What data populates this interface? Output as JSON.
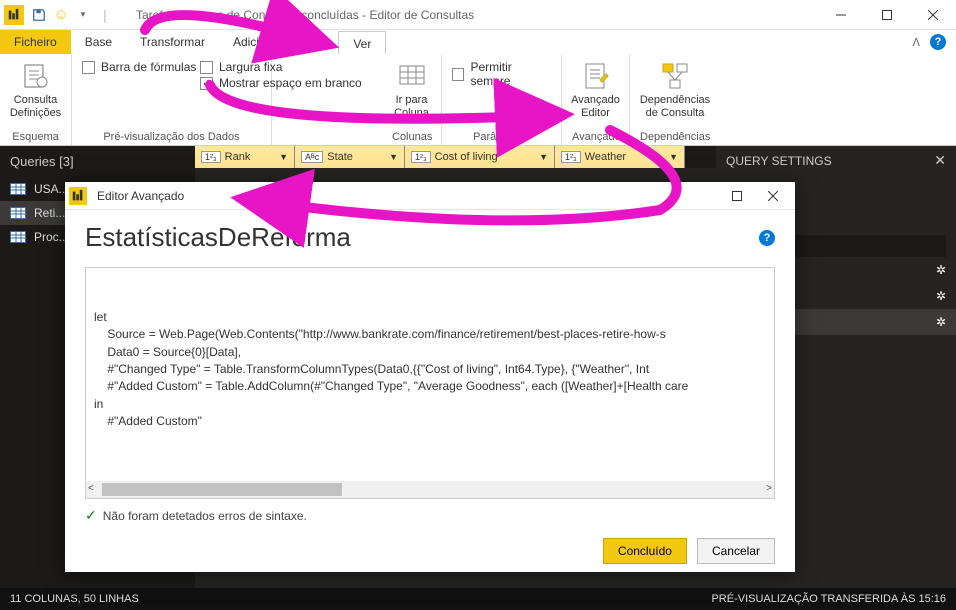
{
  "titlebar": {
    "title": "Tarefas Comuns de Consulta - concluídas - Editor de Consultas"
  },
  "menu": {
    "file": "Ficheiro",
    "base": "Base",
    "transform": "Transformar",
    "addcol": "Adicionar Coluna",
    "view": "Ver"
  },
  "ribbon": {
    "settings_btn": "Consulta\nDefinições",
    "group_schema": "Esquema",
    "formula_bar": "Barra de fórmulas",
    "fixed_width": "Largura fixa",
    "show_whitespace": "Mostrar espaço em branco",
    "group_preview": "Pré-visualização dos Dados",
    "goto_col": "Ir para\nColuna",
    "group_cols": "Colunas",
    "allow_always": "Permitir sempre",
    "group_params": "Parâmetros",
    "adv_editor": "Avançado\nEditor",
    "group_adv": "Avançado",
    "deps": "Dependências\nde Consulta",
    "group_deps": "Dependências"
  },
  "queries": {
    "header": "Queries [3]",
    "items": [
      "USA...",
      "Reti...",
      "Proc..."
    ]
  },
  "columns": [
    {
      "type": "1²₃",
      "name": "Rank"
    },
    {
      "type": "Aᴮc",
      "name": "State"
    },
    {
      "type": "1²₃",
      "name": "Cost of living"
    },
    {
      "type": "1²₃",
      "name": "Weather"
    }
  ],
  "settings_panel": {
    "title": "QUERY SETTINGS"
  },
  "dialog": {
    "title": "Editor Avançado",
    "heading": "EstatísticasDeReforma",
    "code": "let\n    Source = Web.Page(Web.Contents(\"http://www.bankrate.com/finance/retirement/best-places-retire-how-s\n    Data0 = Source{0}[Data],\n    #\"Changed Type\" = Table.TransformColumnTypes(Data0,{{\"Cost of living\", Int64.Type}, {\"Weather\", Int\n    #\"Added Custom\" = Table.AddColumn(#\"Changed Type\", \"Average Goodness\", each ([Weather]+[Health care\nin\n    #\"Added Custom\"",
    "syntax_ok": "Não foram detetados erros de sintaxe.",
    "done": "Concluído",
    "cancel": "Cancelar"
  },
  "status": {
    "left": "11 COLUNAS, 50 LINHAS",
    "right": "PRÉ-VISUALIZAÇÃO TRANSFERIDA ÀS 15:16"
  }
}
